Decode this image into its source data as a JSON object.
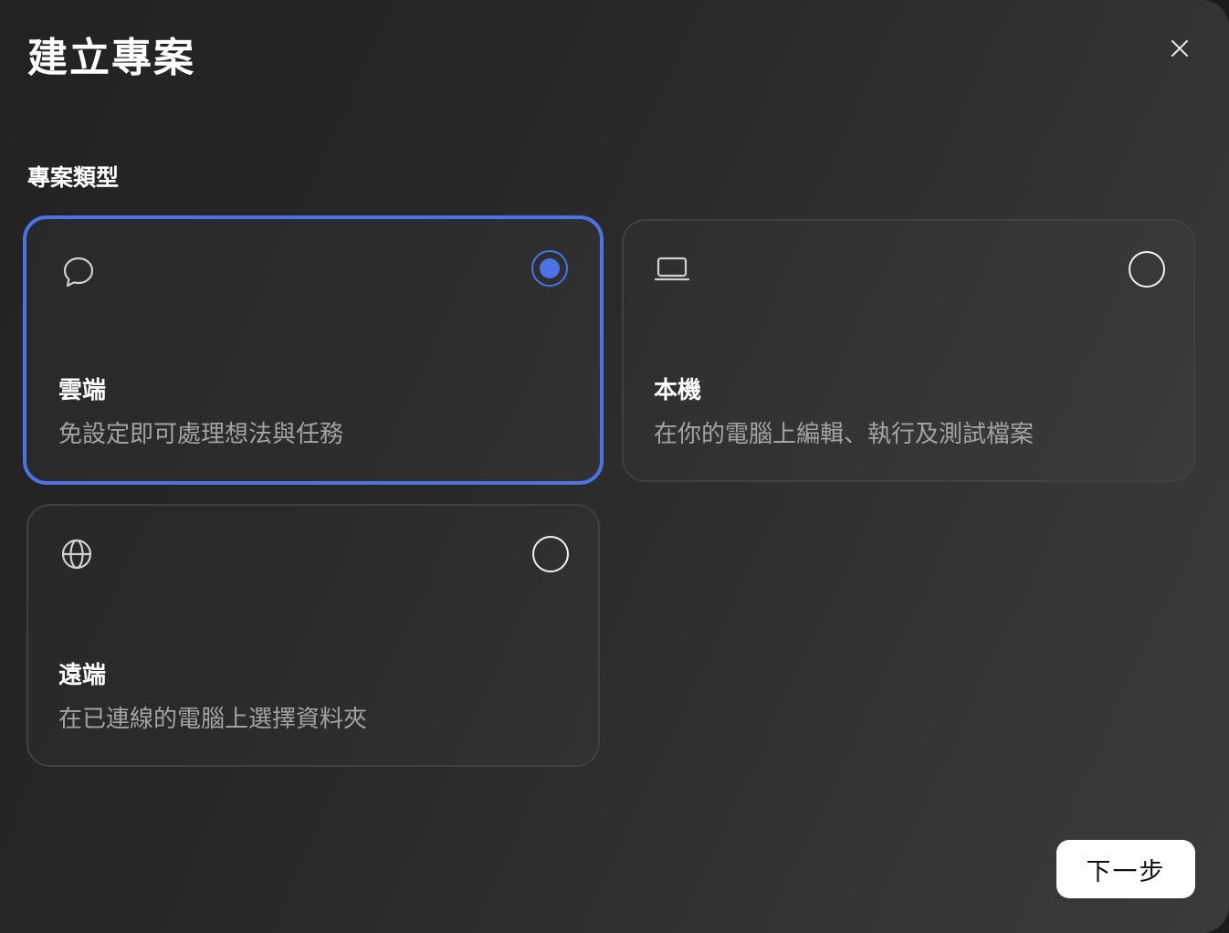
{
  "dialog": {
    "title": "建立專案",
    "close_icon": "close-icon",
    "section_label": "專案類型",
    "options": [
      {
        "id": "cloud",
        "icon": "chat-bubble-icon",
        "title": "雲端",
        "description": "免設定即可處理想法與任務",
        "selected": true
      },
      {
        "id": "local",
        "icon": "laptop-icon",
        "title": "本機",
        "description": "在你的電腦上編輯、執行及測試檔案",
        "selected": false
      },
      {
        "id": "remote",
        "icon": "globe-icon",
        "title": "遠端",
        "description": "在已連線的電腦上選擇資料夾",
        "selected": false
      }
    ],
    "next_label": "下一步",
    "colors": {
      "accent": "#4a73e8",
      "background": "#262626",
      "muted_text": "#a3a3a3"
    }
  }
}
